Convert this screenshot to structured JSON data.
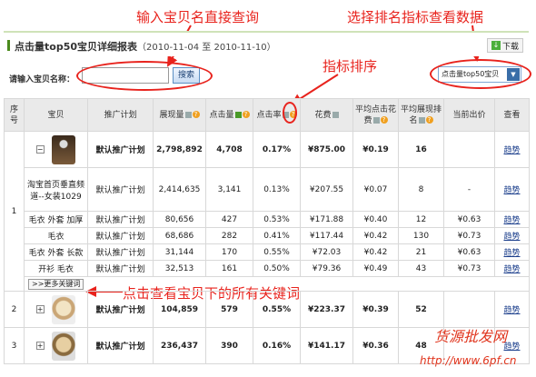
{
  "annotations": {
    "search_hint": "输入宝贝名直接查询",
    "select_hint": "选择排名指标查看数据",
    "sort_hint": "指标排序",
    "more_hint": "点击查看宝贝下的所有关键词"
  },
  "report": {
    "title": "点击量top50宝贝详细报表",
    "date_range": "（2010-11-04 至 2010-11-10）",
    "download_label": "下载"
  },
  "search": {
    "label": "请输入宝贝名称：",
    "value": "",
    "button_label": "搜索"
  },
  "sort_select": {
    "selected": "点击量top50宝贝"
  },
  "table": {
    "headers": [
      "序号",
      "宝贝",
      "推广计划",
      "展现量",
      "点击量",
      "点击率",
      "花费",
      "平均点击花费",
      "平均展现排名",
      "当前出价",
      "查看"
    ],
    "rows": [
      {
        "index": "1",
        "toggle": "−",
        "baby": "",
        "plan": "默认推广计划",
        "impressions": "2,798,892",
        "clicks": "4,708",
        "ctr": "0.17%",
        "cost": "¥875.00",
        "cpc": "¥0.19",
        "rank": "16",
        "bid": "",
        "view": "趋势"
      },
      {
        "baby": "淘宝首页垂直频道--女装1029",
        "plan": "默认推广计划",
        "impressions": "2,414,635",
        "clicks": "3,141",
        "ctr": "0.13%",
        "cost": "¥207.55",
        "cpc": "¥0.07",
        "rank": "8",
        "bid": "-",
        "view": "趋势"
      },
      {
        "baby": "毛衣 外套 加厚",
        "plan": "默认推广计划",
        "impressions": "80,656",
        "clicks": "427",
        "ctr": "0.53%",
        "cost": "¥171.88",
        "cpc": "¥0.40",
        "rank": "12",
        "bid": "¥0.63",
        "view": "趋势"
      },
      {
        "baby": "毛衣",
        "plan": "默认推广计划",
        "impressions": "68,686",
        "clicks": "282",
        "ctr": "0.41%",
        "cost": "¥117.44",
        "cpc": "¥0.42",
        "rank": "130",
        "bid": "¥0.73",
        "view": "趋势"
      },
      {
        "baby": "毛衣 外套 长款",
        "plan": "默认推广计划",
        "impressions": "31,144",
        "clicks": "170",
        "ctr": "0.55%",
        "cost": "¥72.03",
        "cpc": "¥0.42",
        "rank": "21",
        "bid": "¥0.63",
        "view": "趋势"
      },
      {
        "baby": "开衫 毛衣",
        "plan": "默认推广计划",
        "impressions": "32,513",
        "clicks": "161",
        "ctr": "0.50%",
        "cost": "¥79.36",
        "cpc": "¥0.49",
        "rank": "43",
        "bid": "¥0.73",
        "view": "趋势"
      },
      {
        "index": "2",
        "toggle": "+",
        "plan": "默认推广计划",
        "impressions": "104,859",
        "clicks": "579",
        "ctr": "0.55%",
        "cost": "¥223.37",
        "cpc": "¥0.39",
        "rank": "52",
        "bid": "",
        "view": "趋势"
      },
      {
        "index": "3",
        "toggle": "+",
        "plan": "默认推广计划",
        "impressions": "236,437",
        "clicks": "390",
        "ctr": "0.16%",
        "cost": "¥141.17",
        "cpc": "¥0.36",
        "rank": "48",
        "bid": "",
        "view": "趋势"
      }
    ],
    "more_keywords_label": ">>更多关键词"
  },
  "watermark": {
    "text1": "货源批发网",
    "text2": "http://www.6pf.cn"
  },
  "colors": {
    "annotation": "#e8231d",
    "accent_green": "#4a8a1c",
    "link": "#1c3f8c"
  }
}
